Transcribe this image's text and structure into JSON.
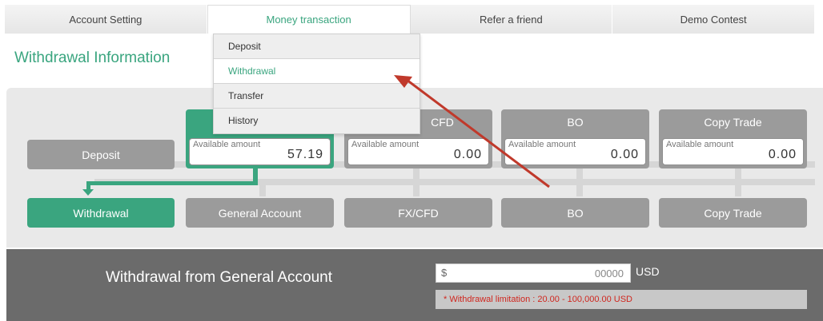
{
  "tabs": [
    {
      "label": "Account Setting"
    },
    {
      "label": "Money transaction"
    },
    {
      "label": "Refer a friend"
    },
    {
      "label": "Demo Contest"
    }
  ],
  "page_title": "Withdrawal Information",
  "menu": {
    "items": [
      {
        "label": "Deposit"
      },
      {
        "label": "Withdrawal"
      },
      {
        "label": "Transfer"
      },
      {
        "label": "History"
      }
    ],
    "selected": "Withdrawal"
  },
  "flow": {
    "deposit_label": "Deposit",
    "withdrawal_label": "Withdrawal",
    "accounts": [
      {
        "name": "",
        "amount_label": "Available amount",
        "amount": "57.19"
      },
      {
        "name": "CFD",
        "amount_label": "Available amount",
        "amount": "0.00"
      },
      {
        "name": "BO",
        "amount_label": "Available amount",
        "amount": "0.00"
      },
      {
        "name": "Copy Trade",
        "amount_label": "Available amount",
        "amount": "0.00"
      }
    ],
    "bottom_buttons": [
      {
        "label": "General Account"
      },
      {
        "label": "FX/CFD"
      },
      {
        "label": "BO"
      },
      {
        "label": "Copy Trade"
      }
    ]
  },
  "withdraw_form": {
    "title": "Withdrawal from General Account",
    "currency_symbol": "$",
    "amount_value": "00000",
    "unit": "USD",
    "limit_text": "* Withdrawal limitation : 20.00 - 100,000.00 USD"
  },
  "colors": {
    "accent": "#3aa57f",
    "gray_box": "#9b9b9b",
    "annotation_arrow": "#c0392b",
    "limit_text": "#d0271f"
  }
}
